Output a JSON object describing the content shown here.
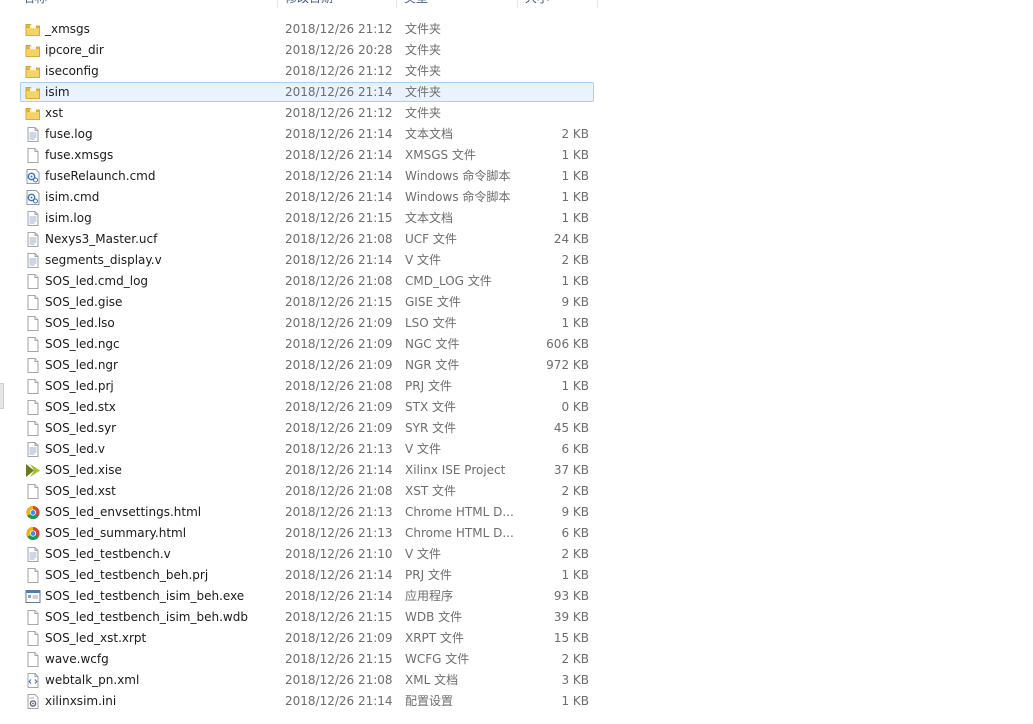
{
  "columns": {
    "name": "名称",
    "date": "修改日期",
    "type": "类型",
    "size": "大小"
  },
  "files": [
    {
      "name": "_xmsgs",
      "date": "2018/12/26 21:12",
      "type": "文件夹",
      "size": "",
      "icon": "folder-icon"
    },
    {
      "name": "ipcore_dir",
      "date": "2018/12/26 20:28",
      "type": "文件夹",
      "size": "",
      "icon": "folder-icon"
    },
    {
      "name": "iseconfig",
      "date": "2018/12/26 21:12",
      "type": "文件夹",
      "size": "",
      "icon": "folder-icon"
    },
    {
      "name": "isim",
      "date": "2018/12/26 21:14",
      "type": "文件夹",
      "size": "",
      "icon": "folder-icon",
      "selected": true
    },
    {
      "name": "xst",
      "date": "2018/12/26 21:12",
      "type": "文件夹",
      "size": "",
      "icon": "folder-icon"
    },
    {
      "name": "fuse.log",
      "date": "2018/12/26 21:14",
      "type": "文本文档",
      "size": "2 KB",
      "icon": "text-file-icon"
    },
    {
      "name": "fuse.xmsgs",
      "date": "2018/12/26 21:14",
      "type": "XMSGS 文件",
      "size": "1 KB",
      "icon": "file-icon"
    },
    {
      "name": "fuseRelaunch.cmd",
      "date": "2018/12/26 21:14",
      "type": "Windows 命令脚本",
      "size": "1 KB",
      "icon": "script-file-icon"
    },
    {
      "name": "isim.cmd",
      "date": "2018/12/26 21:14",
      "type": "Windows 命令脚本",
      "size": "1 KB",
      "icon": "script-file-icon"
    },
    {
      "name": "isim.log",
      "date": "2018/12/26 21:15",
      "type": "文本文档",
      "size": "1 KB",
      "icon": "text-file-icon"
    },
    {
      "name": "Nexys3_Master.ucf",
      "date": "2018/12/26 21:08",
      "type": "UCF 文件",
      "size": "24 KB",
      "icon": "text-file-icon"
    },
    {
      "name": "segments_display.v",
      "date": "2018/12/26 21:14",
      "type": "V 文件",
      "size": "2 KB",
      "icon": "text-file-icon"
    },
    {
      "name": "SOS_led.cmd_log",
      "date": "2018/12/26 21:08",
      "type": "CMD_LOG 文件",
      "size": "1 KB",
      "icon": "file-icon"
    },
    {
      "name": "SOS_led.gise",
      "date": "2018/12/26 21:15",
      "type": "GISE 文件",
      "size": "9 KB",
      "icon": "file-icon"
    },
    {
      "name": "SOS_led.lso",
      "date": "2018/12/26 21:09",
      "type": "LSO 文件",
      "size": "1 KB",
      "icon": "file-icon"
    },
    {
      "name": "SOS_led.ngc",
      "date": "2018/12/26 21:09",
      "type": "NGC 文件",
      "size": "606 KB",
      "icon": "file-icon"
    },
    {
      "name": "SOS_led.ngr",
      "date": "2018/12/26 21:09",
      "type": "NGR 文件",
      "size": "972 KB",
      "icon": "file-icon"
    },
    {
      "name": "SOS_led.prj",
      "date": "2018/12/26 21:08",
      "type": "PRJ 文件",
      "size": "1 KB",
      "icon": "file-icon"
    },
    {
      "name": "SOS_led.stx",
      "date": "2018/12/26 21:09",
      "type": "STX 文件",
      "size": "0 KB",
      "icon": "file-icon"
    },
    {
      "name": "SOS_led.syr",
      "date": "2018/12/26 21:09",
      "type": "SYR 文件",
      "size": "45 KB",
      "icon": "file-icon"
    },
    {
      "name": "SOS_led.v",
      "date": "2018/12/26 21:13",
      "type": "V 文件",
      "size": "6 KB",
      "icon": "text-file-icon"
    },
    {
      "name": "SOS_led.xise",
      "date": "2018/12/26 21:14",
      "type": "Xilinx ISE Project",
      "size": "37 KB",
      "icon": "xilinx-project-icon"
    },
    {
      "name": "SOS_led.xst",
      "date": "2018/12/26 21:08",
      "type": "XST 文件",
      "size": "2 KB",
      "icon": "file-icon"
    },
    {
      "name": "SOS_led_envsettings.html",
      "date": "2018/12/26 21:13",
      "type": "Chrome HTML D...",
      "size": "9 KB",
      "icon": "chrome-icon"
    },
    {
      "name": "SOS_led_summary.html",
      "date": "2018/12/26 21:13",
      "type": "Chrome HTML D...",
      "size": "6 KB",
      "icon": "chrome-icon"
    },
    {
      "name": "SOS_led_testbench.v",
      "date": "2018/12/26 21:10",
      "type": "V 文件",
      "size": "2 KB",
      "icon": "text-file-icon"
    },
    {
      "name": "SOS_led_testbench_beh.prj",
      "date": "2018/12/26 21:14",
      "type": "PRJ 文件",
      "size": "1 KB",
      "icon": "file-icon"
    },
    {
      "name": "SOS_led_testbench_isim_beh.exe",
      "date": "2018/12/26 21:14",
      "type": "应用程序",
      "size": "93 KB",
      "icon": "application-icon"
    },
    {
      "name": "SOS_led_testbench_isim_beh.wdb",
      "date": "2018/12/26 21:15",
      "type": "WDB 文件",
      "size": "39 KB",
      "icon": "file-icon"
    },
    {
      "name": "SOS_led_xst.xrpt",
      "date": "2018/12/26 21:09",
      "type": "XRPT 文件",
      "size": "15 KB",
      "icon": "file-icon"
    },
    {
      "name": "wave.wcfg",
      "date": "2018/12/26 21:15",
      "type": "WCFG 文件",
      "size": "2 KB",
      "icon": "file-icon"
    },
    {
      "name": "webtalk_pn.xml",
      "date": "2018/12/26 21:08",
      "type": "XML 文档",
      "size": "3 KB",
      "icon": "xml-file-icon"
    },
    {
      "name": "xilinxsim.ini",
      "date": "2018/12/26 21:14",
      "type": "配置设置",
      "size": "1 KB",
      "icon": "settings-file-icon"
    }
  ]
}
